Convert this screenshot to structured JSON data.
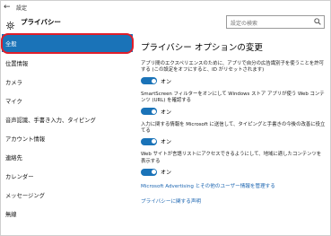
{
  "window": {
    "back_glyph": "←",
    "title": "設定"
  },
  "header": {
    "title": "プライバシー",
    "icon": "gear-icon"
  },
  "search": {
    "placeholder": "設定の検索",
    "icon": "search-icon"
  },
  "sidebar": {
    "items": [
      {
        "label": "全般",
        "selected": true
      },
      {
        "label": "位置情報"
      },
      {
        "label": "カメラ"
      },
      {
        "label": "マイク"
      },
      {
        "label": "音声認識、手書き入力、タイピング"
      },
      {
        "label": "アカウント情報"
      },
      {
        "label": "連絡先"
      },
      {
        "label": "カレンダー"
      },
      {
        "label": "メッセージング"
      },
      {
        "label": "無線"
      }
    ]
  },
  "main": {
    "heading": "プライバシー オプションの変更",
    "options": [
      {
        "desc": "アプリ間のエクスペリエンスのために、アプリで自分の広告識別子を使うことを許可する (この設定をオフにすると、ID がリセットされます)",
        "state": "オン"
      },
      {
        "desc": "SmartScreen フィルターをオンにして Windows ストア アプリが使う Web コンテンツ (URL) を確認する",
        "state": "オン"
      },
      {
        "desc": "入力に関する情報を Microsoft に送信して、タイピングと手書きの今後の改善に役立てる",
        "state": "オン"
      },
      {
        "desc": "Web サイトが言語リストにアクセスできるようにして、地域に適したコンテンツを表示する",
        "state": "オン"
      }
    ],
    "links": [
      "Microsoft Advertising とその他のユーザー情報を管理する",
      "プライバシーに関する声明"
    ]
  },
  "colors": {
    "accent": "#1a73b8",
    "highlight": "#e01e2a",
    "link": "#1a64b0"
  }
}
